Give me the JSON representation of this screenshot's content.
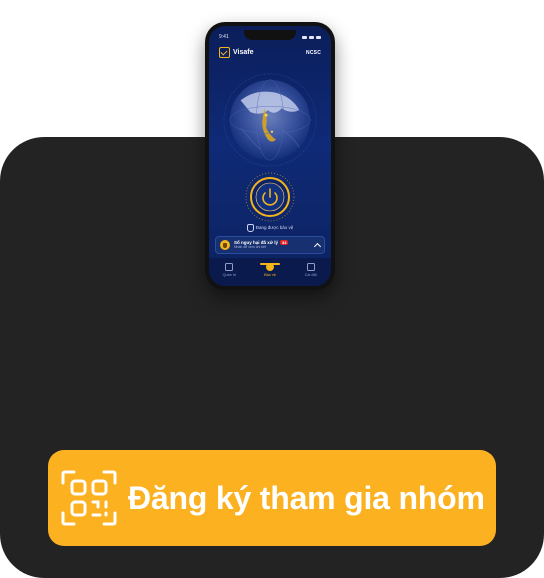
{
  "phone": {
    "status_time": "9:41",
    "app_name": "Visafe",
    "partner_logo": "NCSC",
    "protect_status": "Đang được bảo vệ",
    "threat_card": {
      "title": "Số nguy hại đã xử lý",
      "count": "34",
      "subtitle": "Nhấn để xem chi tiết"
    },
    "tabs": [
      {
        "label": "Quản trị",
        "icon": "admin-icon"
      },
      {
        "label": "Bảo vệ",
        "icon": "protect-icon",
        "active": true
      },
      {
        "label": "Cài đặt",
        "icon": "settings-icon"
      }
    ],
    "colors": {
      "accent": "#f3b51a",
      "screen_bg": "#0f2a77"
    }
  },
  "cta": {
    "label": "Đăng ký tham gia nhóm",
    "icon": "qr-code-icon",
    "bg_color": "#fbb120",
    "text_color": "#ffffff"
  },
  "card": {
    "bg_color": "#232323"
  }
}
